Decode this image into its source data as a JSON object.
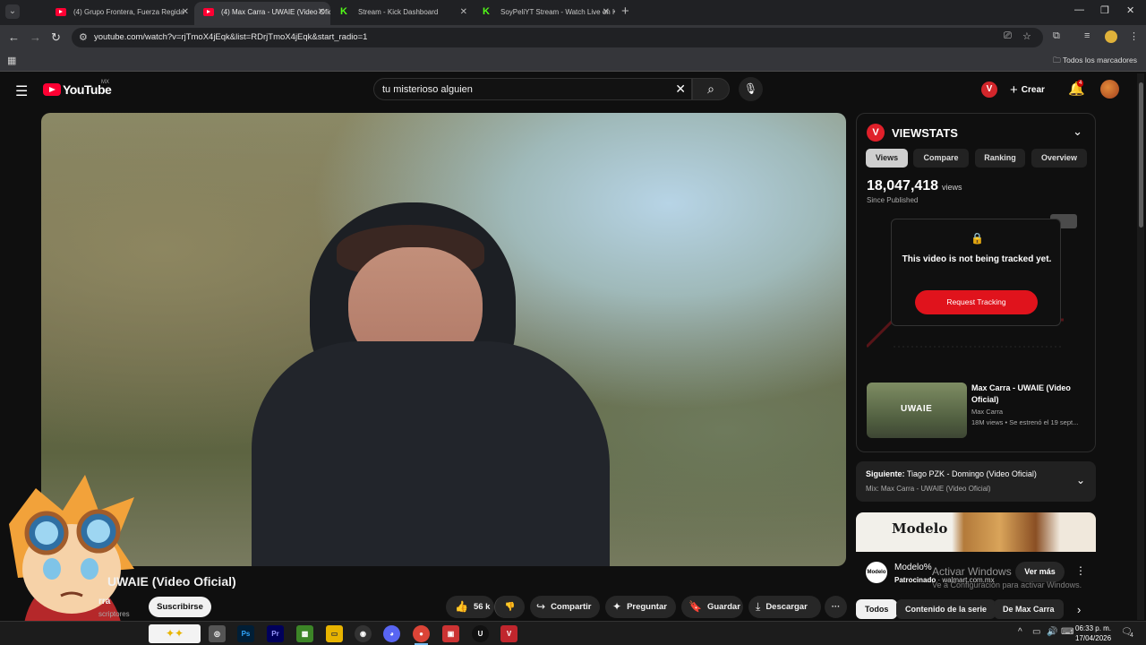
{
  "browser": {
    "tabs": [
      {
        "title": "(4) Grupo Frontera, Fuerza Regida",
        "icon": "youtube-icon",
        "active": false
      },
      {
        "title": "(4) Max Carra - UWAIE (Video Oficial)",
        "icon": "youtube-icon",
        "active": true,
        "muted_indicator": "🔊"
      },
      {
        "title": "Stream - Kick Dashboard",
        "icon": "kick-icon",
        "active": false
      },
      {
        "title": "SoyPeliYT Stream - Watch Live on Kick",
        "icon": "kick-icon",
        "active": false
      }
    ],
    "url": "youtube.com/watch?v=rjTmoX4jEqk&list=RDrjTmoX4jEqk&start_radio=1",
    "all_bookmarks": "Todos los marcadores"
  },
  "youtube": {
    "logo_text": "YouTube",
    "country_code": "MX",
    "search_query": "tu misterioso alguien",
    "create_label": "Crear",
    "notifications_count": "4"
  },
  "video": {
    "title": "UWAIE (Video Oficial)",
    "channel": "rra",
    "subscribers": "scriptores",
    "subscribe_label": "Suscribirse",
    "likes": "56 k",
    "share_label": "Compartir",
    "ask_label": "Preguntar",
    "save_label": "Guardar",
    "download_label": "Descargar",
    "more_label": "···"
  },
  "viewstats": {
    "brand": "VIEWSTATS",
    "logo_letter": "V",
    "tabs": [
      "Views",
      "Compare",
      "Ranking",
      "Overview"
    ],
    "active_tab": "Views",
    "views": "18,047,418",
    "views_unit": "views",
    "since": "Since Published",
    "not_tracked_msg": "This video is not being tracked yet.",
    "request_label": "Request Tracking",
    "card": {
      "thumb_label": "UWAIE",
      "title": "Max Carra - UWAIE (Video Oficial)",
      "channel": "Max Carra",
      "meta": "18M views • Se estrenó el 19 sept..."
    }
  },
  "playlist": {
    "next_prefix": "Siguiente:",
    "next_title": "Tiago PZK - Domingo (Video Oficial)",
    "mix": "Mix: Max Carra - UWAIE (Video Oficial)"
  },
  "ad": {
    "brand_text": "Modelo",
    "advertiser": "Modelo%",
    "sponsored": "Patrocinado",
    "domain": "walmart.com.mx",
    "cta": "Ver más",
    "logo_text": "Modelo"
  },
  "windows_activation": {
    "line1": "Activar Windows",
    "line2": "Ve a Configuración para activar Windows."
  },
  "chips": [
    "Todos",
    "Contenido de la serie",
    "De Max Carra"
  ],
  "taskbar": {
    "apps": [
      "Ps",
      "Pr"
    ],
    "time": "06:33 p. m.",
    "date": "17/04/2026",
    "notif_count": "4"
  },
  "colors": {
    "yt_red": "#ff0033",
    "viewstats_red": "#e0202a",
    "kick_green": "#53fc18",
    "background": "#0f0f0f"
  }
}
